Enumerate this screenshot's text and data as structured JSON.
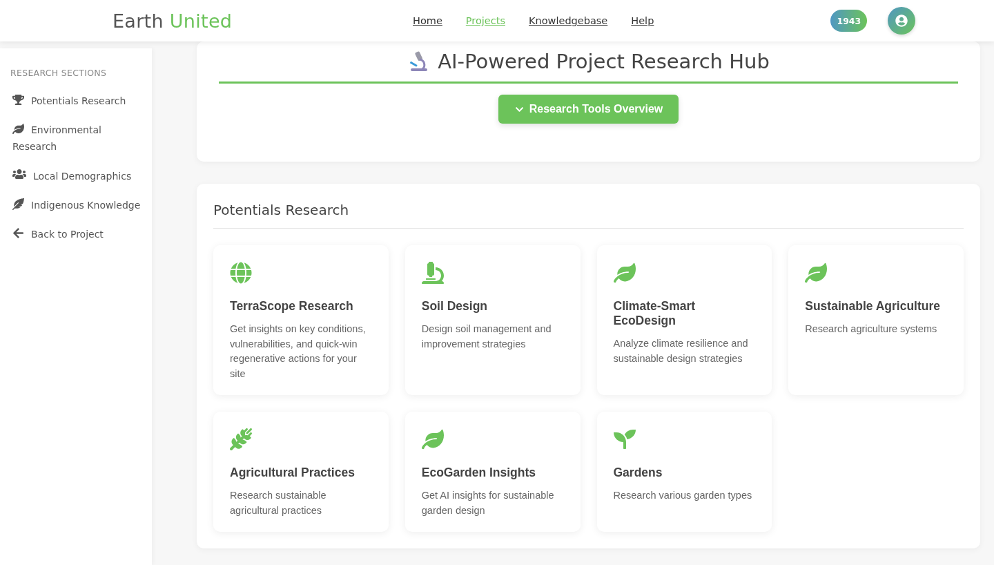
{
  "header": {
    "logo": {
      "first": "Earth",
      "second": "United"
    },
    "nav": [
      {
        "label": "Home",
        "selected": false
      },
      {
        "label": "Projects",
        "selected": true
      },
      {
        "label": "Knowledgebase",
        "selected": false
      },
      {
        "label": "Help",
        "selected": false
      }
    ],
    "points": "1943"
  },
  "sidebar": {
    "heading": "RESEARCH SECTIONS",
    "items": [
      {
        "label": "Potentials Research"
      },
      {
        "label": "Environmental Research"
      },
      {
        "label": "Local Demographics"
      },
      {
        "label": "Indigenous Knowledge"
      },
      {
        "label": "Back to Project"
      }
    ]
  },
  "hub": {
    "title": "AI-Powered Project Research Hub",
    "button": "Research Tools Overview"
  },
  "section": {
    "title": "Potentials Research",
    "cards": [
      {
        "title": "TerraScope Research",
        "text": "Get insights on key conditions, vulnerabilities, and quick-win regenerative actions for your site"
      },
      {
        "title": "Soil Design",
        "text": "Design soil management and improvement strategies"
      },
      {
        "title": "Climate-Smart EcoDesign",
        "text": "Analyze climate resilience and sustainable design strategies"
      },
      {
        "title": "Sustainable Agriculture",
        "text": "Research agriculture systems"
      },
      {
        "title": "Agricultural Practices",
        "text": "Research sustainable agricultural practices"
      },
      {
        "title": "EcoGarden Insights",
        "text": "Get AI insights for sustainable garden design"
      },
      {
        "title": "Gardens",
        "text": "Research various garden types"
      }
    ]
  }
}
